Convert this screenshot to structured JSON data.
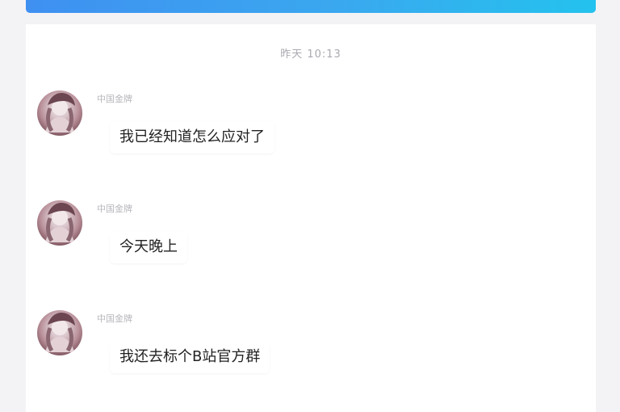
{
  "header": {
    "accent_start": "#3f90f1",
    "accent_end": "#24c2ee"
  },
  "chat": {
    "timestamp": "昨天 10:13",
    "messages": [
      {
        "sender": "中国金牌",
        "text": "我已经知道怎么应对了",
        "avatar_icon": "user-avatar-icon"
      },
      {
        "sender": "中国金牌",
        "text": "今天晚上",
        "avatar_icon": "user-avatar-icon"
      },
      {
        "sender": "中国金牌",
        "text": "我还去标个B站官方群",
        "avatar_icon": "user-avatar-icon"
      }
    ]
  }
}
